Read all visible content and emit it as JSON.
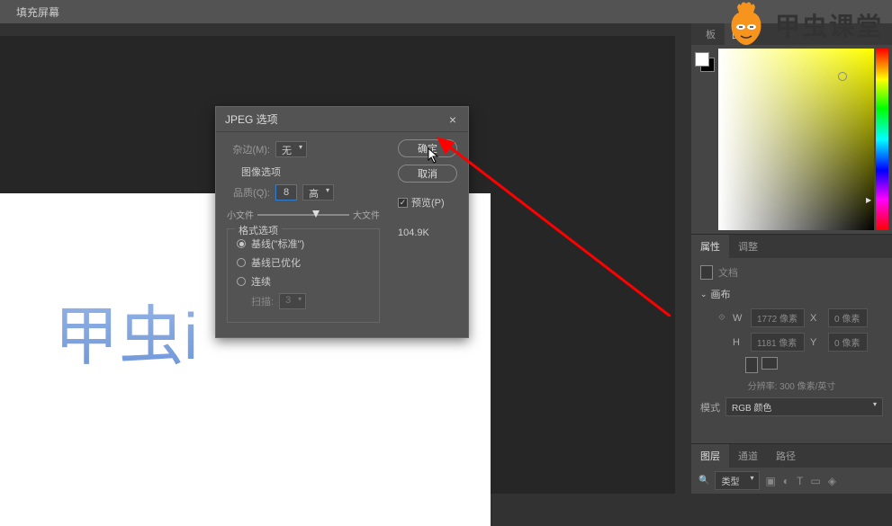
{
  "menubar": {
    "fill_screen": "填充屏幕"
  },
  "canvas": {
    "sample_text": "甲虫i"
  },
  "dialog": {
    "title": "JPEG 选项",
    "matte_label": "杂边(M):",
    "matte_value": "无",
    "image_options": "图像选项",
    "quality_label": "品质(Q):",
    "quality_value": "8",
    "quality_preset": "高",
    "small_file": "小文件",
    "large_file": "大文件",
    "format_options": "格式选项",
    "radio_baseline": "基线(\"标准\")",
    "radio_optimized": "基线已优化",
    "radio_progressive": "连续",
    "scans_label": "扫描:",
    "scans_value": "3",
    "ok": "确定",
    "cancel": "取消",
    "preview": "预览(P)",
    "file_size": "104.9K"
  },
  "right_panel": {
    "tab_board": "板",
    "tab_image": "图",
    "props_tab": "属性",
    "adjust_tab": "调整",
    "document_label": "文档",
    "canvas_header": "画布",
    "w_label": "W",
    "w_value": "1772 像素",
    "x_label": "X",
    "x_value": "0 像素",
    "h_label": "H",
    "h_value": "1181 像素",
    "y_label": "Y",
    "y_value": "0 像素",
    "resolution": "分辨率: 300 像素/英寸",
    "mode_label": "模式",
    "mode_value": "RGB 颜色",
    "layers_tab": "图层",
    "channels_tab": "通道",
    "paths_tab": "路径",
    "layer_type": "类型"
  },
  "watermark": {
    "text": "甲虫课堂"
  }
}
